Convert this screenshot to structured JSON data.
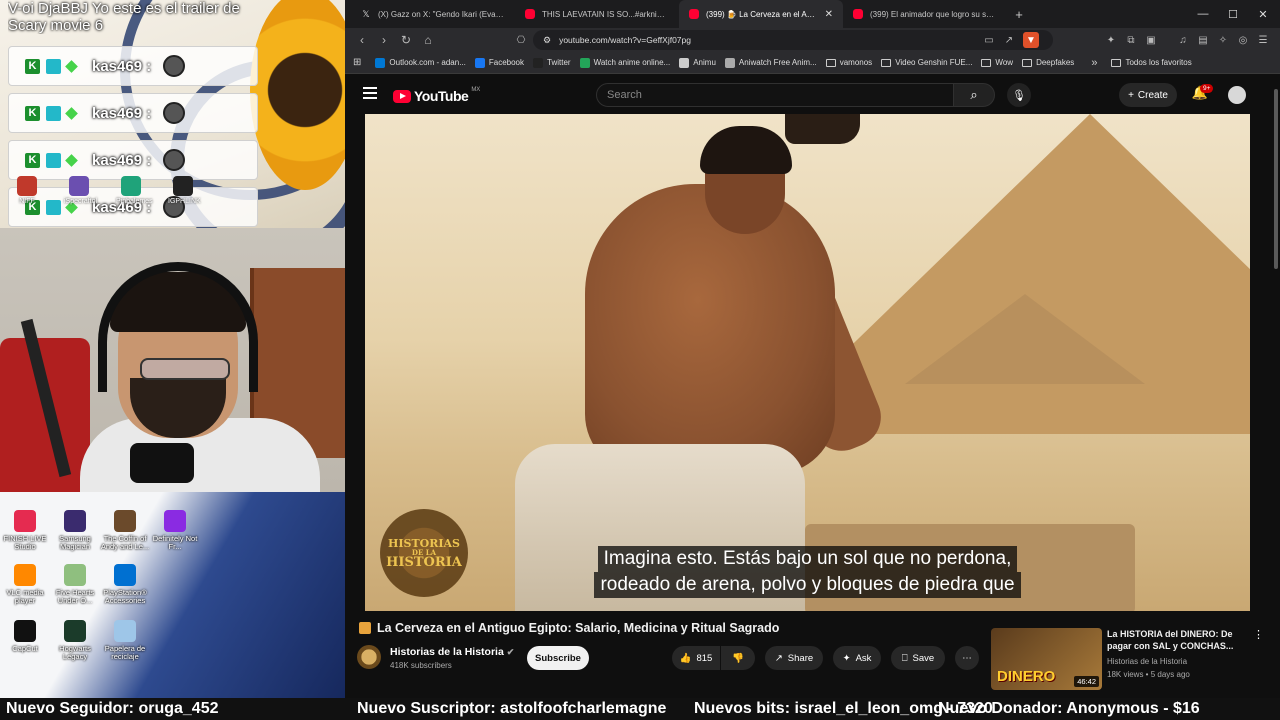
{
  "chat": {
    "top_text": "V-oi DjaBBJ Yo este es el trailer de Scary movie 6",
    "messages": [
      {
        "user": "kas469 :"
      },
      {
        "user": "kas469 :"
      },
      {
        "user": "kas469 :"
      },
      {
        "user": "kas469 :"
      }
    ],
    "small_icons": [
      "NIFF",
      "iSpecraftol",
      "Pinbalemes",
      "IGPHLINK"
    ]
  },
  "desktop": {
    "icons": [
      {
        "label": "FINISH LIVE Studio",
        "color": "#e52b50"
      },
      {
        "label": "Samsung Magician",
        "color": "#3a2b6e"
      },
      {
        "label": "The Coffin of Andy and Le...",
        "color": "#6b4a2b"
      },
      {
        "label": "Definitely Not Fr...",
        "color": "#8a2be2"
      },
      {
        "label": "VLC media player",
        "color": "#ff8800"
      },
      {
        "label": "Five Hearts Under O...",
        "color": "#8fbf7f"
      },
      {
        "label": "PlayStation® Accessories",
        "color": "#0070d1"
      },
      {
        "label": "CapCut",
        "color": "#111111"
      },
      {
        "label": "Hogwarts Legacy",
        "color": "#1b3b2a"
      },
      {
        "label": "Papelera de reciclaje",
        "color": "#9ec6e8"
      }
    ]
  },
  "browser": {
    "tabs": [
      {
        "label": "(X) Gazz on X: \"Gendo Ikari (Evangeli...",
        "icon": "x-icon",
        "active": false
      },
      {
        "label": "THIS LAEVATAIN IS SO...#arknightsen",
        "icon": "youtube-icon",
        "active": false
      },
      {
        "label": "(399) 🍺 La Cerveza en el Antigu",
        "icon": "youtube-icon",
        "active": true
      },
      {
        "label": "(399) El animador que logro su sueño",
        "icon": "youtube-icon",
        "active": false
      }
    ],
    "url": "youtube.com/watch?v=GeffXjf07pg",
    "bookmarks": [
      {
        "label": "Outlook.com - adan...",
        "color": "#0078d4",
        "folder": false
      },
      {
        "label": "Facebook",
        "color": "#1877f2",
        "folder": false
      },
      {
        "label": "Twitter",
        "color": "#222222",
        "folder": false
      },
      {
        "label": "Watch anime online...",
        "color": "#23a559",
        "folder": false
      },
      {
        "label": "Animu",
        "color": "#cccccc",
        "folder": false
      },
      {
        "label": "Aniwatch Free Anim...",
        "color": "#aaaaaa",
        "folder": false
      },
      {
        "label": "vamonos",
        "color": "",
        "folder": true
      },
      {
        "label": "Video Genshin FUE...",
        "color": "",
        "folder": true
      },
      {
        "label": "Wow",
        "color": "",
        "folder": true
      },
      {
        "label": "Deepfakes",
        "color": "",
        "folder": true
      }
    ],
    "bookmarks_all": "Todos los favoritos"
  },
  "youtube": {
    "logo": "YouTube",
    "country": "MX",
    "search_placeholder": "Search",
    "create_label": "Create",
    "notif_count": "9+",
    "subtitle_lines": [
      "Imagina esto. Estás bajo un sol que no perdona,",
      "rodeado de arena, polvo y bloques de piedra que"
    ],
    "watermark": [
      "HISTORIAS",
      "DE LA",
      "HISTORIA"
    ],
    "video_title": "La Cerveza en el Antiguo Egipto: Salario, Medicina y Ritual Sagrado",
    "channel_name": "Historias de la Historia",
    "channel_subs": "418K subscribers",
    "subscribe_label": "Subscribe",
    "likes": "815",
    "share_label": "Share",
    "ask_label": "Ask",
    "save_label": "Save",
    "recommendation": {
      "title": "La HISTORIA del DINERO: De pagar con SAL y CONCHAS...",
      "channel": "Historias de la Historia",
      "meta": "18K views • 5 days ago",
      "duration": "46:42",
      "thumb_text": "DINERO"
    }
  },
  "ticker": {
    "follower": "Nuevo Seguidor: oruga_452",
    "subscriber": "Nuevo Suscriptor: astolfoofcharlemagne",
    "bits": "Nuevos bits: israel_el_leon_omg - 7320",
    "donor": "Nuevo Donador: Anonymous - $16"
  }
}
